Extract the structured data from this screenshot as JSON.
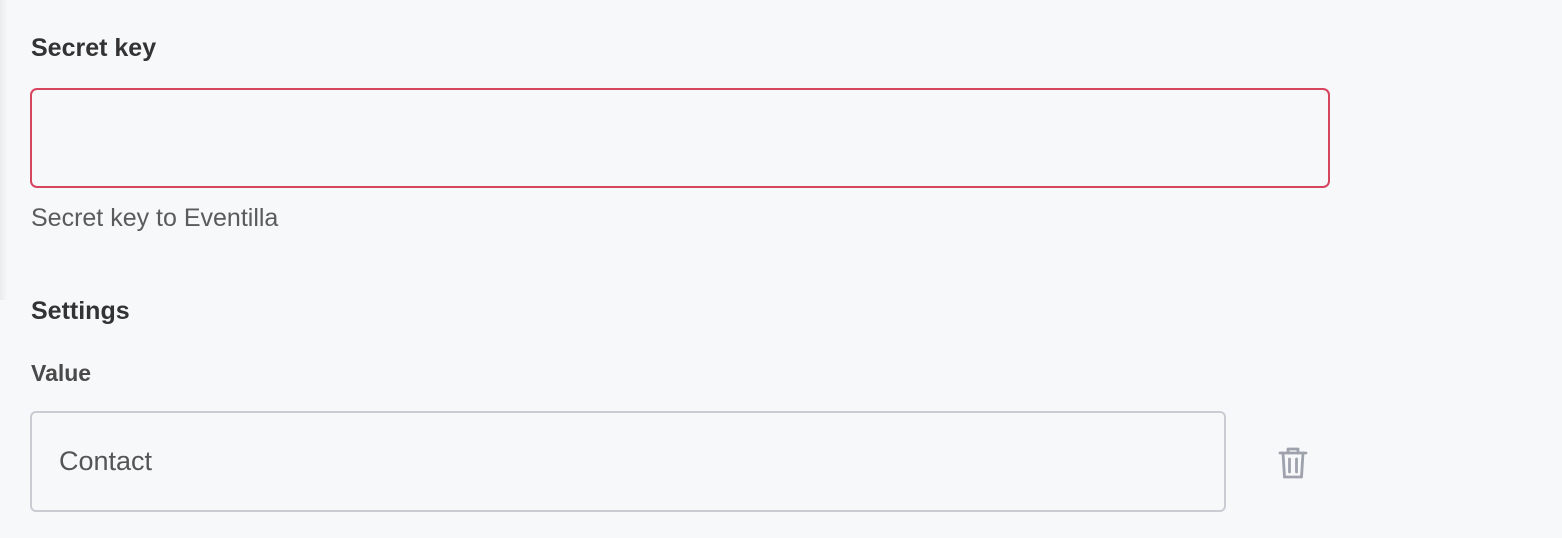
{
  "secret_key": {
    "label": "Secret key",
    "value": "",
    "help_text": "Secret key to Eventilla"
  },
  "settings": {
    "label": "Settings",
    "value_field": {
      "label": "Value",
      "value": "Contact"
    },
    "delete_icon": "trash-icon"
  },
  "colors": {
    "background": "#f7f8fa",
    "error_border": "#d6455e",
    "input_border": "#c9ccd3",
    "icon": "#9ea2ad"
  }
}
